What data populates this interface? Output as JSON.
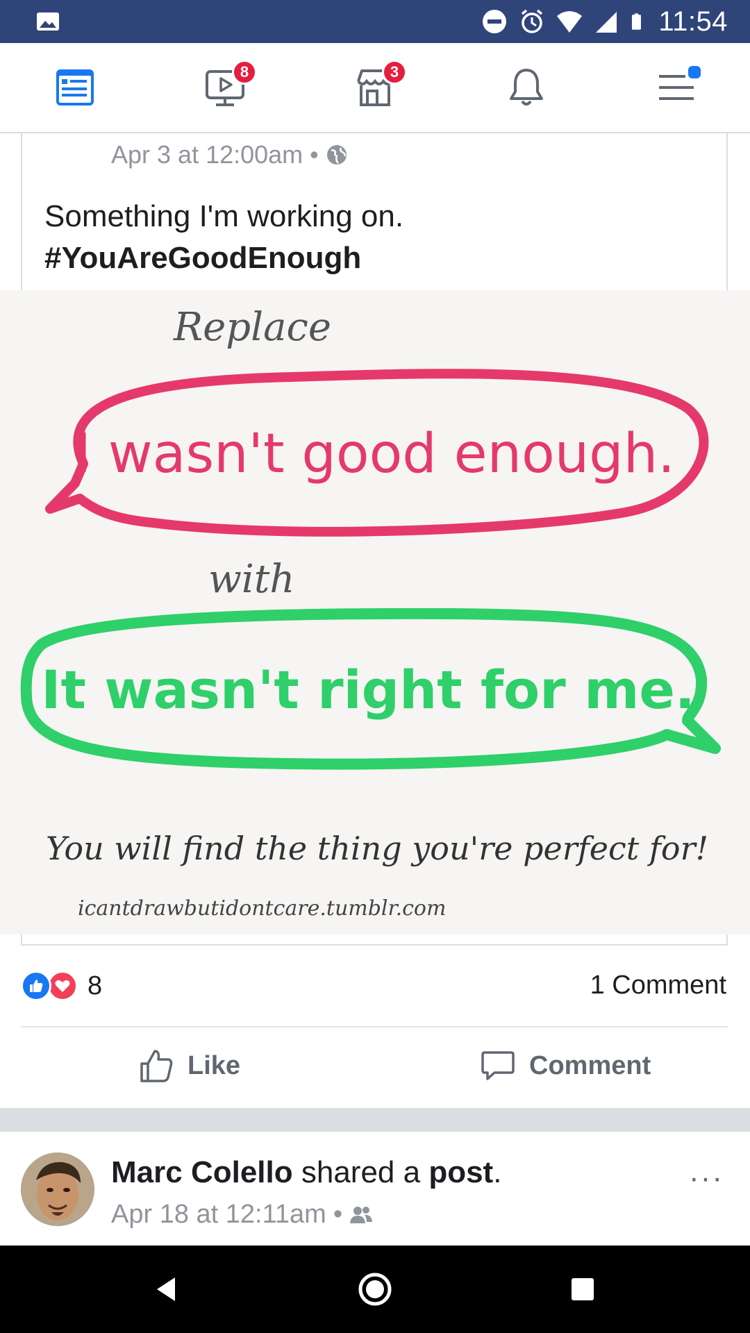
{
  "status_bar": {
    "time": "11:54",
    "icons": [
      "gallery-icon",
      "dnd-icon",
      "alarm-icon",
      "wifi-icon",
      "signal-icon",
      "battery-icon"
    ]
  },
  "nav": {
    "items": [
      {
        "name": "news-feed",
        "icon": "news-feed-icon",
        "badge": ""
      },
      {
        "name": "watch",
        "icon": "watch-icon",
        "badge": "8"
      },
      {
        "name": "marketplace",
        "icon": "marketplace-icon",
        "badge": "3"
      },
      {
        "name": "notifications",
        "icon": "bell-icon",
        "badge": ""
      },
      {
        "name": "menu",
        "icon": "menu-icon",
        "badge": ""
      }
    ],
    "accent": "#1877f2",
    "badge_color": "#e41e3f"
  },
  "post": {
    "timestamp": "Apr 3 at 12:00am",
    "separator": "•",
    "privacy_icon": "globe-icon",
    "text_line1": "Something I'm working on.",
    "hashtag": "#YouAreGoodEnough",
    "image": {
      "line_replace": "Replace",
      "bubble1": "I wasn't good enough.",
      "line_with": "with",
      "bubble2": "It wasn't right for me.",
      "footer": "You will find the thing you're perfect for!",
      "credit": "icantdrawbutidontcare.tumblr.com",
      "bubble1_color": "#e5396b",
      "bubble2_color": "#2fcf6a"
    },
    "reaction_count": "8",
    "comment_count": "1 Comment",
    "like_label": "Like",
    "comment_label": "Comment"
  },
  "next_post": {
    "author": "Marc Colello",
    "action_text": "shared a",
    "object": "post",
    "period": ".",
    "timestamp": "Apr 18 at 12:11am",
    "separator": "•",
    "privacy_icon": "friends-icon",
    "more_label": "···"
  }
}
